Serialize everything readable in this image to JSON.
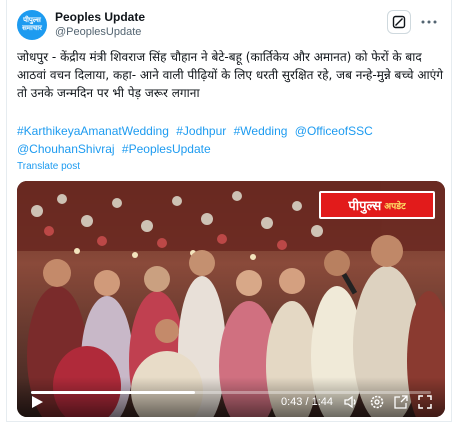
{
  "account": {
    "avatar_text": "पीपुल्स\nसमाचार",
    "name": "Peoples Update",
    "handle": "@PeoplesUpdate"
  },
  "tweet": {
    "text": "जोधपुर - केंद्रीय मंत्री शिवराज सिंह चौहान ने बेटे-बहू (कार्तिकेय और अमानत) को फेरों के बाद आठवां वचन दिलाया, कहा- आने वाली पीढ़ियों के लिए धरती सुरक्षित रहे, जब नन्हे-मुन्ने बच्चे आएंगे तो उनके जन्मदिन पर भी पेड़ जरूर लगाना",
    "hashtags": [
      "#KarthikeyaAmanatWedding",
      "#Jodhpur",
      "#Wedding",
      "@OfficeofSSC",
      "@ChouhanShivraj",
      "#PeoplesUpdate"
    ],
    "translate_label": "Translate post"
  },
  "video": {
    "logo_main": "पीपुल्स",
    "logo_sub": "अपडेट",
    "current_time": "0:43",
    "duration": "1:44",
    "time_display": "0:43 / 1:44",
    "progress": 0.41
  },
  "icons": {
    "grok": "grok-icon",
    "more": "more-icon",
    "play": "play-icon",
    "volume": "volume-icon",
    "settings": "settings-icon",
    "pip": "pip-icon",
    "fullscreen": "fullscreen-icon"
  },
  "colors": {
    "link": "#1d9bf0",
    "brand_red": "#e21b1b"
  }
}
